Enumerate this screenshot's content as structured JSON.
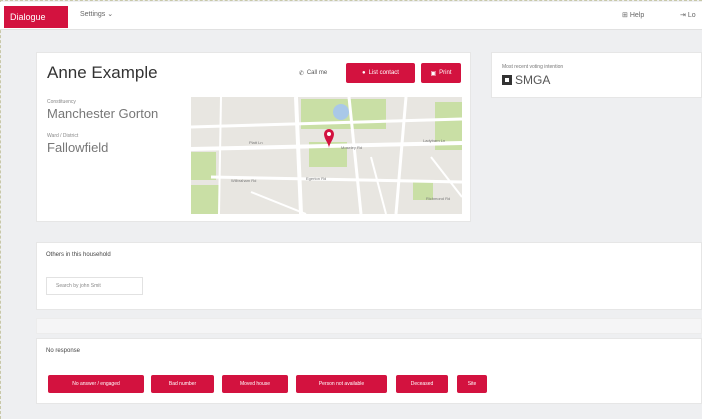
{
  "topbar": {
    "brand": "Dialogue",
    "settings_label": "Settings ⌄",
    "help_label": "Help",
    "logout_label": "Lo"
  },
  "person": {
    "name": "Anne Example",
    "constituency_label": "Constituency",
    "constituency_value": "Manchester Gorton",
    "ward_label": "Ward / District",
    "ward_value": "Fallowfield"
  },
  "actions": {
    "call_label": "Call me",
    "contact_label": "List contact",
    "print_label": "Print"
  },
  "map": {
    "labels": [
      "Platt Ln",
      "Wilbraham Rd",
      "Moseley Rd",
      "Egerton Rd",
      "Ladybarn Ln",
      "Richmond Rd"
    ]
  },
  "side": {
    "label": "Most recent voting intention",
    "value": "SMGA"
  },
  "household": {
    "title": "Others in this household",
    "search_placeholder": "Search by john Smit"
  },
  "no_response": {
    "title": "No response",
    "buttons": [
      "No answer / engaged",
      "Bad number",
      "Moved house",
      "Person not available",
      "Deceased",
      "Site"
    ]
  },
  "colors": {
    "accent": "#d3123f",
    "background": "#eeeff1",
    "card": "#ffffff"
  }
}
